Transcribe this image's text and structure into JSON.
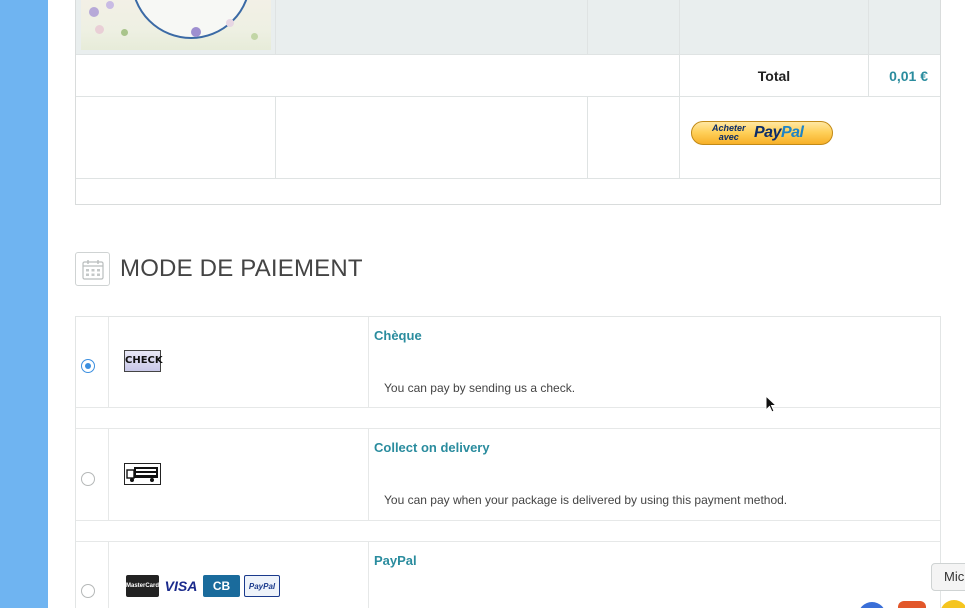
{
  "cart": {
    "total_label": "Total",
    "total_value": "0,01 €",
    "paypal_button": {
      "line1": "Acheter",
      "line2": "avec",
      "brand_pay": "Pay",
      "brand_pal": "Pal"
    }
  },
  "payment_section": {
    "title": "MODE DE PAIEMENT",
    "icon": "calendar-icon",
    "methods": [
      {
        "name": "Chèque",
        "description": "You can pay by sending us a check.",
        "logo_text": "CHECK",
        "selected": true
      },
      {
        "name": "Collect on delivery",
        "description": "You can pay when your package is delivered by using this payment method.",
        "selected": false
      },
      {
        "name": "PayPal",
        "selected": false,
        "card_logos": [
          "MasterCard",
          "VISA",
          "CB",
          "PayPal"
        ]
      }
    ]
  },
  "overlay": {
    "mic_label": "Mic"
  },
  "colors": {
    "accent_teal": "#2a8c9e",
    "left_strip": "#6fb4f1",
    "radio_selected": "#3b8fe0"
  }
}
